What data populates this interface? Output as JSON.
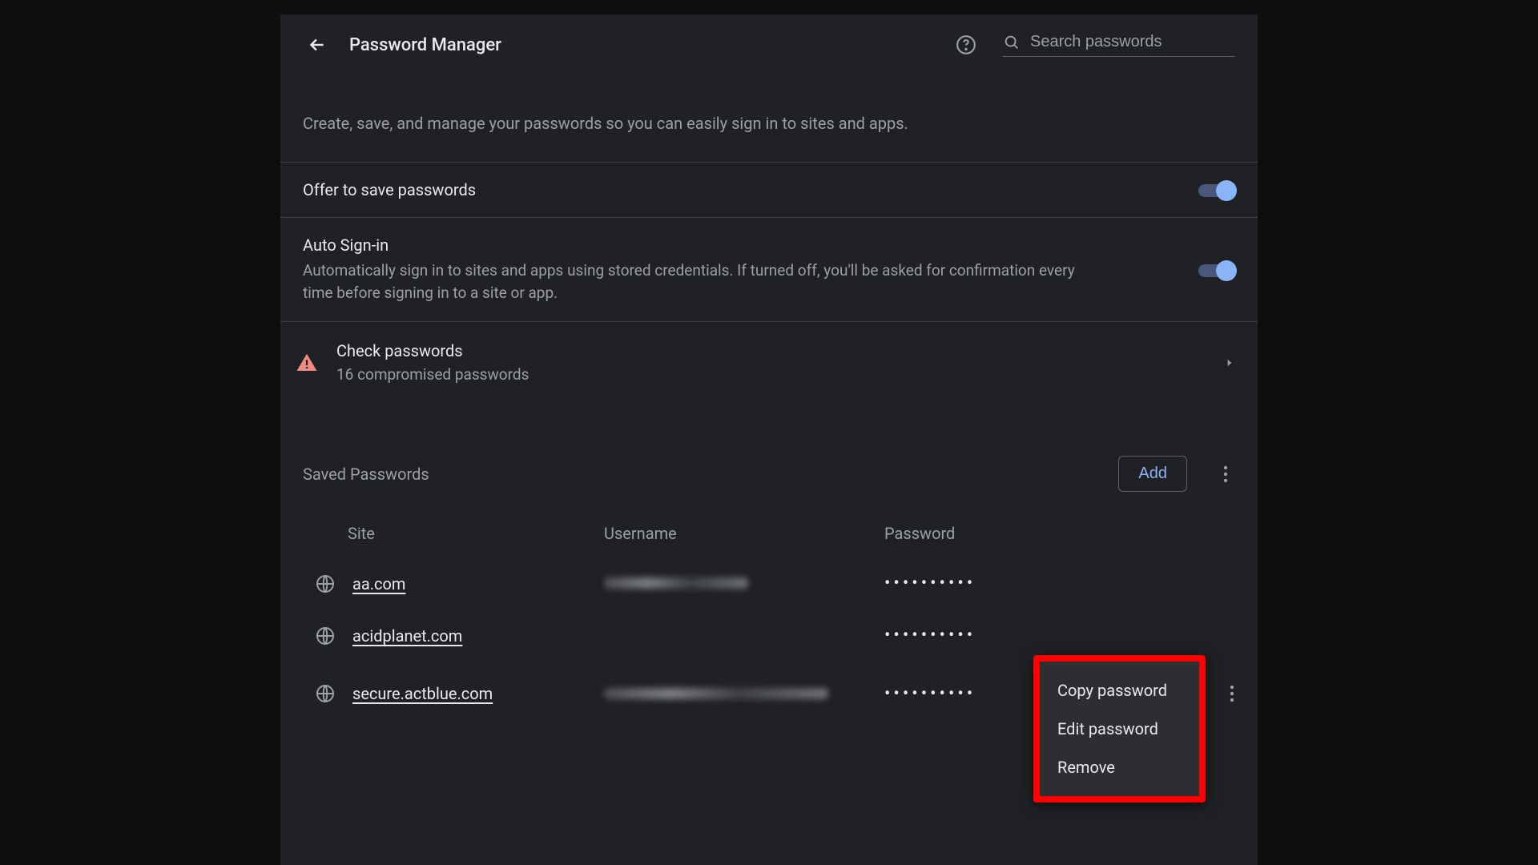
{
  "header": {
    "title": "Password Manager",
    "search_placeholder": "Search passwords"
  },
  "intro_text": "Create, save, and manage your passwords so you can easily sign in to sites and apps.",
  "settings": {
    "offer_save": {
      "title": "Offer to save passwords",
      "enabled": true
    },
    "auto_signin": {
      "title": "Auto Sign-in",
      "desc": "Automatically sign in to sites and apps using stored credentials. If turned off, you'll be asked for confirmation every time before signing in to a site or app.",
      "enabled": true
    }
  },
  "check_passwords": {
    "title": "Check passwords",
    "subtitle": "16 compromised passwords"
  },
  "saved": {
    "header": "Saved Passwords",
    "add_label": "Add",
    "columns": {
      "site": "Site",
      "username": "Username",
      "password": "Password"
    },
    "rows": [
      {
        "site": "aa.com",
        "username_obscured": true,
        "password_mask": "••••••••••"
      },
      {
        "site": "acidplanet.com",
        "username_obscured": false,
        "password_mask": "••••••••••"
      },
      {
        "site": "secure.actblue.com",
        "username_obscured": true,
        "password_mask": "••••••••••"
      }
    ]
  },
  "context_menu": {
    "items": [
      "Copy password",
      "Edit password",
      "Remove"
    ]
  }
}
